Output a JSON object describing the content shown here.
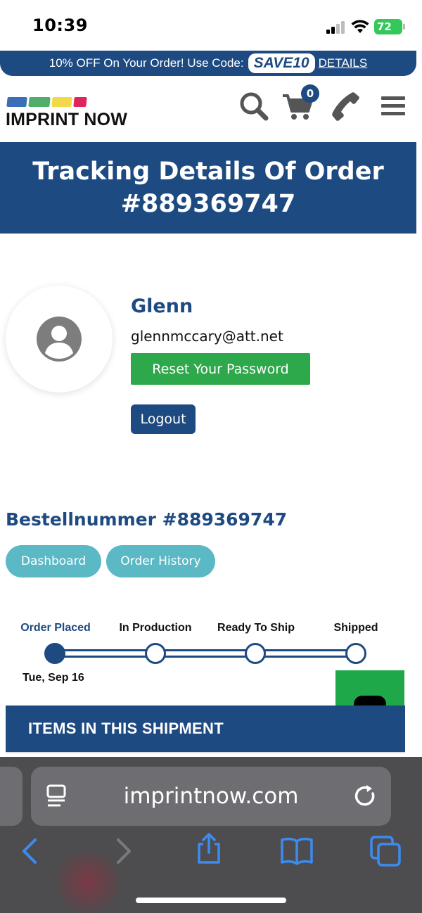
{
  "status_bar": {
    "time": "10:39",
    "battery": "72"
  },
  "promo": {
    "text": "10% OFF On Your Order! Use Code:",
    "code": "SAVE10",
    "details": "DETAILS"
  },
  "header": {
    "brand": "IMPRINT NOW",
    "cart_count": "0",
    "icons": [
      "search-icon",
      "cart-icon",
      "phone-icon",
      "menu-icon"
    ]
  },
  "page": {
    "title": "Tracking Details Of Order #889369747"
  },
  "profile": {
    "name": "Glenn",
    "email": "glennmccary@att.net",
    "reset_label": "Reset Your Password",
    "logout_label": "Logout"
  },
  "order": {
    "number_label": "Bestellnummer #889369747",
    "tabs": [
      {
        "label": "Dashboard"
      },
      {
        "label": "Order History"
      }
    ],
    "steps": [
      {
        "label": "Order Placed",
        "date": "Tue, Sep 16",
        "done": true
      },
      {
        "label": "In Production",
        "done": false
      },
      {
        "label": "Ready To Ship",
        "done": false
      },
      {
        "label": "Shipped",
        "done": false
      }
    ],
    "shipment_title": "ITEMS IN THIS SHIPMENT"
  },
  "browser": {
    "url": "imprintnow.com"
  },
  "colors": {
    "brand_blue": "#1e4a82",
    "green": "#2da84a",
    "teal": "#5bb9c6",
    "chat_green": "#1ea84a"
  }
}
